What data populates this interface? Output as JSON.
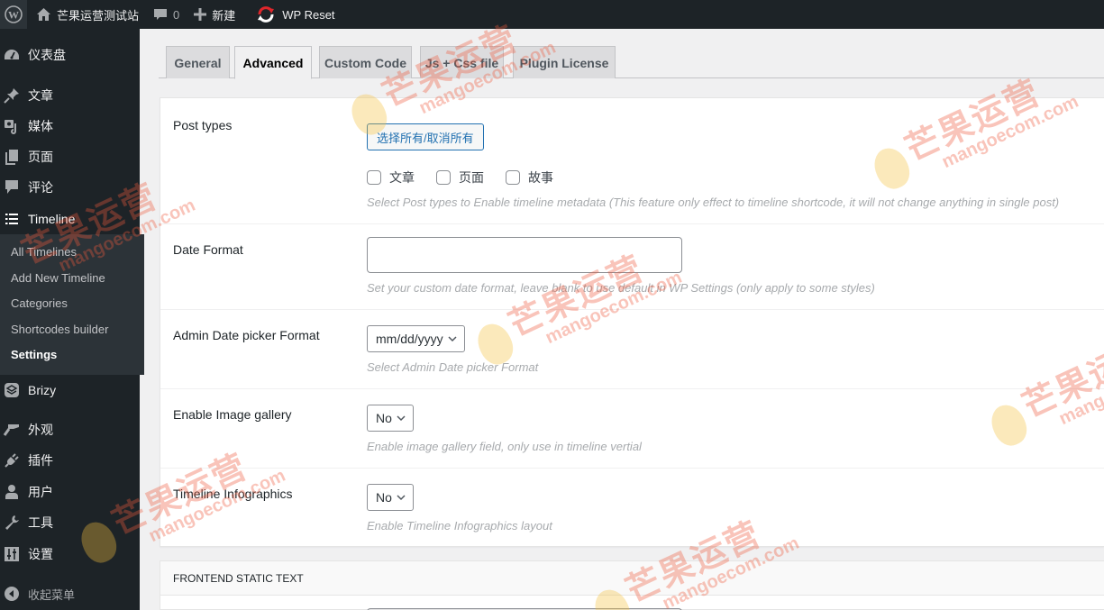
{
  "admin_bar": {
    "site_name": "芒果运营测试站",
    "comments_count": "0",
    "new_label": "新建",
    "plugin_label": "WP Reset"
  },
  "sidebar": {
    "items": [
      {
        "label": "仪表盘",
        "icon": "dashboard-icon"
      },
      {
        "label": "文章",
        "icon": "pin-icon"
      },
      {
        "label": "媒体",
        "icon": "media-icon"
      },
      {
        "label": "页面",
        "icon": "pages-icon"
      },
      {
        "label": "评论",
        "icon": "comments-icon"
      },
      {
        "label": "Timeline",
        "icon": "list-icon"
      },
      {
        "label": "Brizy",
        "icon": "brizy-icon"
      },
      {
        "label": "外观",
        "icon": "brush-icon"
      },
      {
        "label": "插件",
        "icon": "plugin-icon"
      },
      {
        "label": "用户",
        "icon": "user-icon"
      },
      {
        "label": "工具",
        "icon": "wrench-icon"
      },
      {
        "label": "设置",
        "icon": "settings-icon"
      }
    ],
    "submenu": [
      {
        "label": "All Timelines"
      },
      {
        "label": "Add New Timeline"
      },
      {
        "label": "Categories"
      },
      {
        "label": "Shortcodes builder"
      },
      {
        "label": "Settings",
        "active": true
      }
    ],
    "collapse_label": "收起菜单"
  },
  "tabs": [
    {
      "label": "General"
    },
    {
      "label": "Advanced",
      "active": true
    },
    {
      "label": "Custom Code"
    },
    {
      "label": "Js + Css file"
    },
    {
      "label": "Plugin License"
    }
  ],
  "settings": {
    "post_types": {
      "label": "Post types",
      "select_all_label": "选择所有/取消所有",
      "options": [
        {
          "label": "文章",
          "checked": false
        },
        {
          "label": "页面",
          "checked": false
        },
        {
          "label": "故事",
          "checked": false
        }
      ],
      "description": "Select Post types to Enable timeline metadata (This feature only effect to timeline shortcode, it will not change anything in single post)"
    },
    "date_format": {
      "label": "Date Format",
      "value": "",
      "description": "Set your custom date format, leave blank to use default in WP Settings (only apply to some styles)"
    },
    "admin_date_picker": {
      "label": "Admin Date picker Format",
      "value": "mm/dd/yyyy",
      "description": "Select Admin Date picker Format"
    },
    "image_gallery": {
      "label": "Enable Image gallery",
      "value": "No",
      "description": "Enable image gallery field, only use in timeline vertial"
    },
    "infographics": {
      "label": "Timeline Infographics",
      "value": "No",
      "description": "Enable Timeline Infographics layout"
    }
  },
  "frontend_section": {
    "title": "FRONTEND STATIC TEXT"
  },
  "watermark": {
    "cn": "芒果运营",
    "en": "mangoecom.com"
  }
}
